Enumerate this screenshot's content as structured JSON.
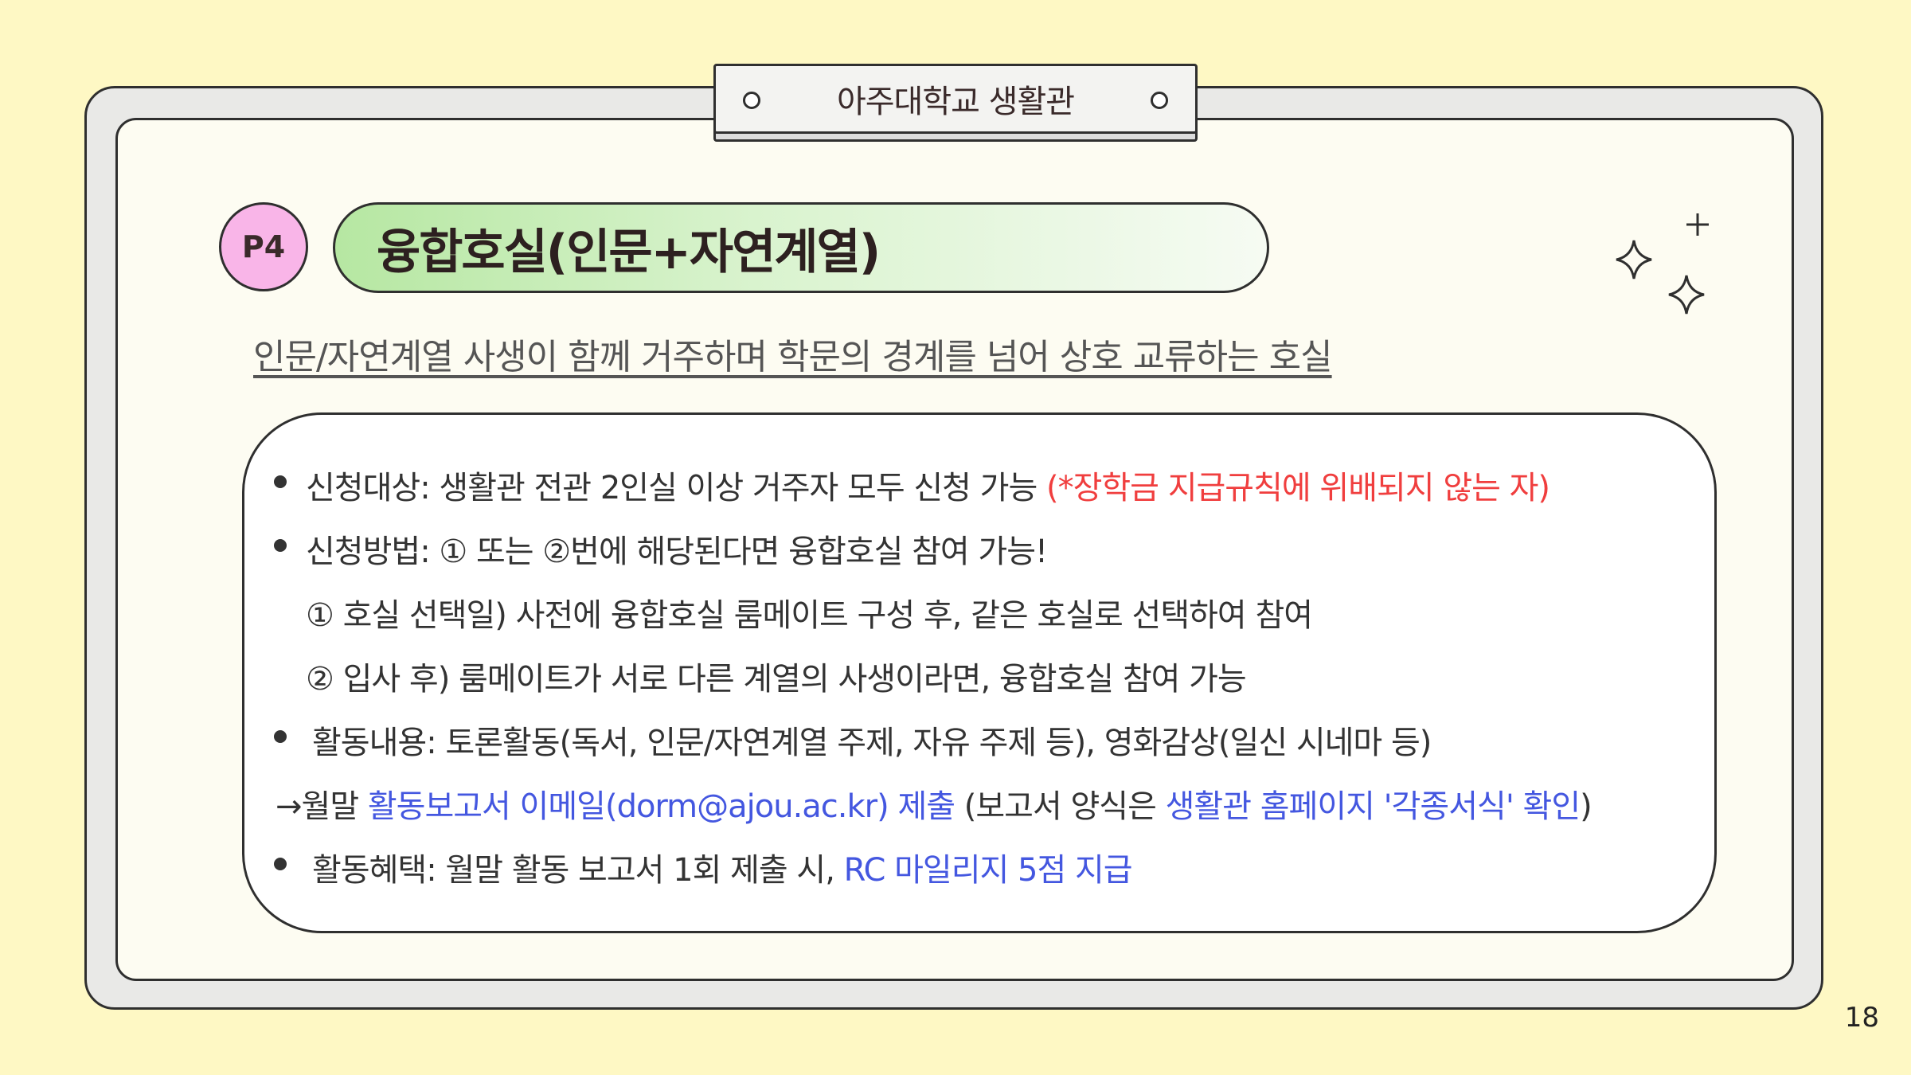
{
  "header": {
    "title": "아주대학교 생활관"
  },
  "badge": "P4",
  "section": {
    "title": "융합호실(인문+자연계열)",
    "subtitle": "인문/자연계열 사생이 함께 거주하며 학문의 경계를 넘어 상호 교류하는 호실"
  },
  "details": {
    "line1_a": "신청대상: 생활관 전관 2인실 이상 거주자 모두 신청 가능 ",
    "line1_b": "(*장학금 지급규칙에 위배되지 않는 자)",
    "line2": "신청방법: ①  또는 ②번에 해당된다면 융합호실 참여 가능!",
    "line3": "① 호실 선택일) 사전에 융합호실 룸메이트 구성 후, 같은 호실로 선택하여 참여",
    "line4": "② 입사 후) 룸메이트가 서로 다른 계열의 사생이라면, 융합호실 참여 가능",
    "line5": "활동내용: 토론활동(독서, 인문/자연계열 주제, 자유 주제 등), 영화감상(일신 시네마 등)",
    "line6_a": "→월말 ",
    "line6_b": "활동보고서 이메일(dorm@ajou.ac.kr) 제출",
    "line6_c": " (보고서 양식은 ",
    "line6_d": "생활관 홈페이지 '각종서식' 확인",
    "line6_e": ")",
    "line7_a": "활동혜택: 월말 활동 보고서 1회 제출 시, ",
    "line7_b": "RC 마일리지 5점 지급"
  },
  "page_number": "18",
  "colors": {
    "background": "#fef8c4",
    "highlight_red": "#f03e3e",
    "highlight_blue": "#4457e0",
    "badge": "#f9b5e8",
    "title_green": "#b6e7a2"
  }
}
